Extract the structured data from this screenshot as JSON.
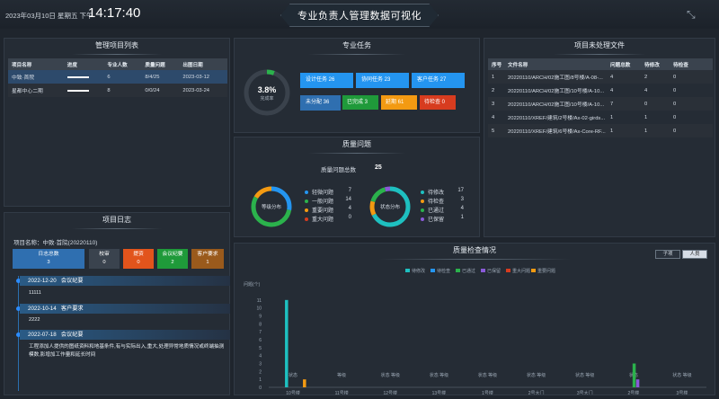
{
  "header": {
    "date": "2023年03月10日 星期五 下午",
    "time": "14:17:40",
    "title": "专业负责人管理数据可视化"
  },
  "projects": {
    "title": "管理项目列表",
    "cols": [
      "项目名称",
      "进度",
      "专业人数",
      "质量问题",
      "出图日期"
    ],
    "rows": [
      [
        "中致·首院",
        "6",
        "8/4/25",
        "2023-03-12"
      ],
      [
        "星都中心二期",
        "8",
        "0/0/24",
        "2023-03-24"
      ]
    ]
  },
  "tasks": {
    "title": "专业任务",
    "pct": "3.8%",
    "sub": "完成率",
    "design": "设计任务  26",
    "collab": "协同任务  23",
    "client": "客户任务  27",
    "unpublished": "未分配  36",
    "done": "已完成  3",
    "overdue": "延期  61",
    "pending": "待检查  0"
  },
  "quality": {
    "title": "质量问题",
    "total_label": "质量问题总数",
    "total": "25",
    "d1": "等级分布",
    "d2": "状态分布",
    "left": [
      [
        "轻微问题",
        "7"
      ],
      [
        "一般问题",
        "14"
      ],
      [
        "重要问题",
        "4"
      ],
      [
        "重大问题",
        "0"
      ]
    ],
    "right": [
      [
        "待修改",
        "17"
      ],
      [
        "待检查",
        "3"
      ],
      [
        "已通过",
        "4"
      ],
      [
        "已保留",
        "1"
      ]
    ]
  },
  "files": {
    "title": "项目未处理文件",
    "cols": [
      "序号",
      "文件名称",
      "问题总数",
      "待修改",
      "待检查"
    ],
    "rows": [
      [
        "1",
        "20220110/ARCH/02施工图/8号楼/A-08-...",
        "4",
        "2",
        "0"
      ],
      [
        "2",
        "20220110/ARCH/02施工图/10号楼/A-10...",
        "4",
        "4",
        "0"
      ],
      [
        "3",
        "20220110/ARCH/02施工图/10号楼/A-10...",
        "7",
        "0",
        "0"
      ],
      [
        "4",
        "20220110/XREF/建筑/2号楼/Ax-02-girds...",
        "1",
        "1",
        "0"
      ],
      [
        "5",
        "20220110/XREF/建筑/6号楼/Ax-Core-RF...",
        "1",
        "1",
        "0"
      ]
    ]
  },
  "log": {
    "title": "项目日志",
    "project": "项目名称：中致·首院(20220110)",
    "stats": [
      [
        "日志总数",
        "3"
      ],
      [
        "校审",
        "0"
      ],
      [
        "提资",
        "0"
      ],
      [
        "会议纪要",
        "2"
      ],
      [
        "客户要求",
        "1"
      ]
    ],
    "items": [
      [
        "2022-12-20",
        "会议纪要",
        "11111"
      ],
      [
        "2022-10-14",
        "客户要求",
        "2222"
      ],
      [
        "2022-07-18",
        "会议纪要",
        "工程添加人提供的图纸资料和地基条件,有与实际出入,重大,处理异常地质情况或终端抽测模数,影增加工作量和延长时间"
      ]
    ]
  },
  "check": {
    "title": "质量检查情况",
    "tab1": "子项",
    "tab2": "人员",
    "ylabel": "问题(个)",
    "legend": [
      "待修改",
      "待检查",
      "已通过",
      "已保留",
      "重大问题",
      "重要问题"
    ]
  },
  "chart_data": {
    "type": "bar",
    "title": "质量检查情况",
    "ylabel": "问题(个)",
    "ylim": [
      0,
      12
    ],
    "categories": [
      "10号楼",
      "11号楼",
      "12号楼",
      "13号楼",
      "1号楼",
      "2号大门",
      "3号大门",
      "2号楼",
      "3号楼"
    ],
    "series": [
      {
        "name": "待修改",
        "values": [
          11,
          0,
          0,
          0,
          0,
          0,
          0,
          0,
          0
        ]
      },
      {
        "name": "待检查",
        "values": [
          0,
          0,
          0,
          0,
          0,
          0,
          0,
          0,
          0
        ]
      },
      {
        "name": "已通过",
        "values": [
          0,
          0,
          0,
          0,
          0,
          0,
          0,
          3,
          0
        ]
      },
      {
        "name": "已保留",
        "values": [
          0,
          0,
          0,
          0,
          0,
          0,
          0,
          1,
          0
        ]
      },
      {
        "name": "重大问题",
        "values": [
          0,
          0,
          0,
          0,
          0,
          0,
          0,
          0,
          0
        ]
      },
      {
        "name": "重要问题",
        "values": [
          1,
          0,
          0,
          0,
          0,
          0,
          0,
          0,
          0
        ]
      }
    ],
    "yticks": [
      "0",
      "1",
      "2",
      "3",
      "4",
      "5",
      "6",
      "7",
      "8",
      "9",
      "10",
      "11"
    ],
    "labels": [
      "状态",
      "等级",
      "状态 等级",
      "状态 等级",
      "状态 等级",
      "状态 等级",
      "状态 等级",
      "状态",
      "状态 等级"
    ]
  }
}
